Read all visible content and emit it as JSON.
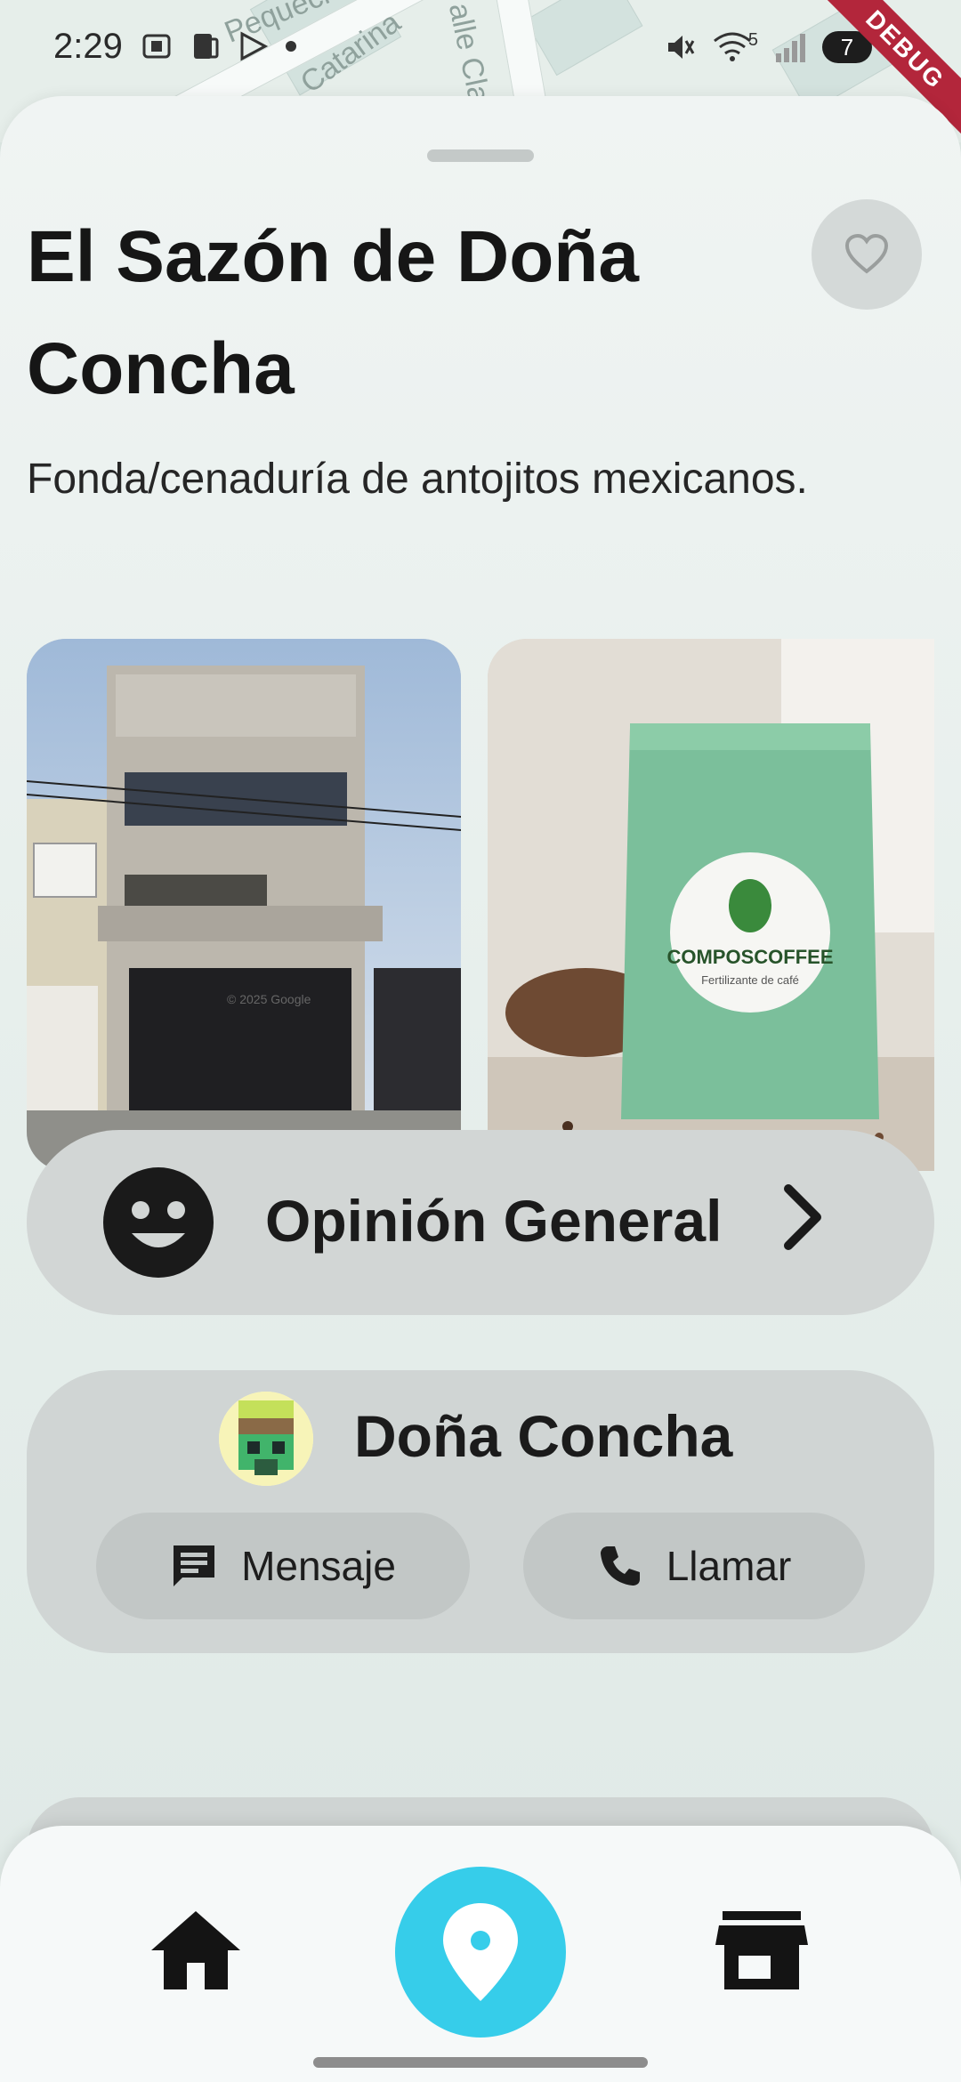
{
  "status_bar": {
    "time": "2:29",
    "battery": "7",
    "network": "5",
    "debug_label": "DEBUG"
  },
  "map": {
    "street_labels": [
      "Pequeci",
      "Catarina",
      "alle Cla"
    ]
  },
  "place": {
    "name": "El Sazón de Doña Concha",
    "description": "Fonda/cenaduría de antojitos mexicanos.",
    "photos": [
      {
        "alt": "Fachada de edificio",
        "watermark": "© 2025 Google"
      },
      {
        "alt": "Bolsa de café",
        "brand": "COMPOSCOFFEE",
        "tagline": "Fertilizante de café"
      }
    ]
  },
  "opinion": {
    "label": "Opinión General",
    "icon": "smiley-face-icon"
  },
  "owner": {
    "name": "Doña Concha",
    "message_label": "Mensaje",
    "call_label": "Llamar"
  },
  "nav": {
    "items": [
      "home-icon",
      "map-pin-icon",
      "store-icon"
    ]
  },
  "colors": {
    "accent": "#36cdea",
    "debug": "#b3263b"
  }
}
